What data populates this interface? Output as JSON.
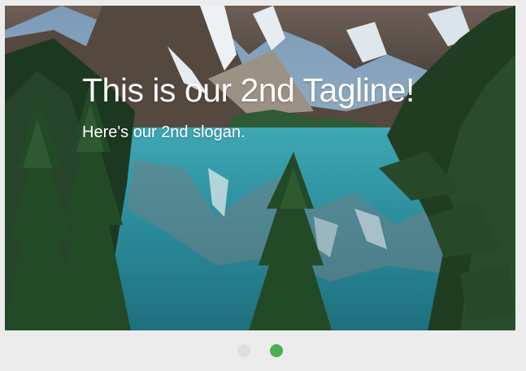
{
  "slider": {
    "tagline": "This is our 2nd Tagline!",
    "slogan": "Here's our 2nd slogan.",
    "image_subject": "mountain-lake-with-pine-trees"
  },
  "pagination": {
    "dots": [
      {
        "active": false
      },
      {
        "active": true
      }
    ],
    "active_color": "#4caf50",
    "inactive_color": "#dedede"
  }
}
